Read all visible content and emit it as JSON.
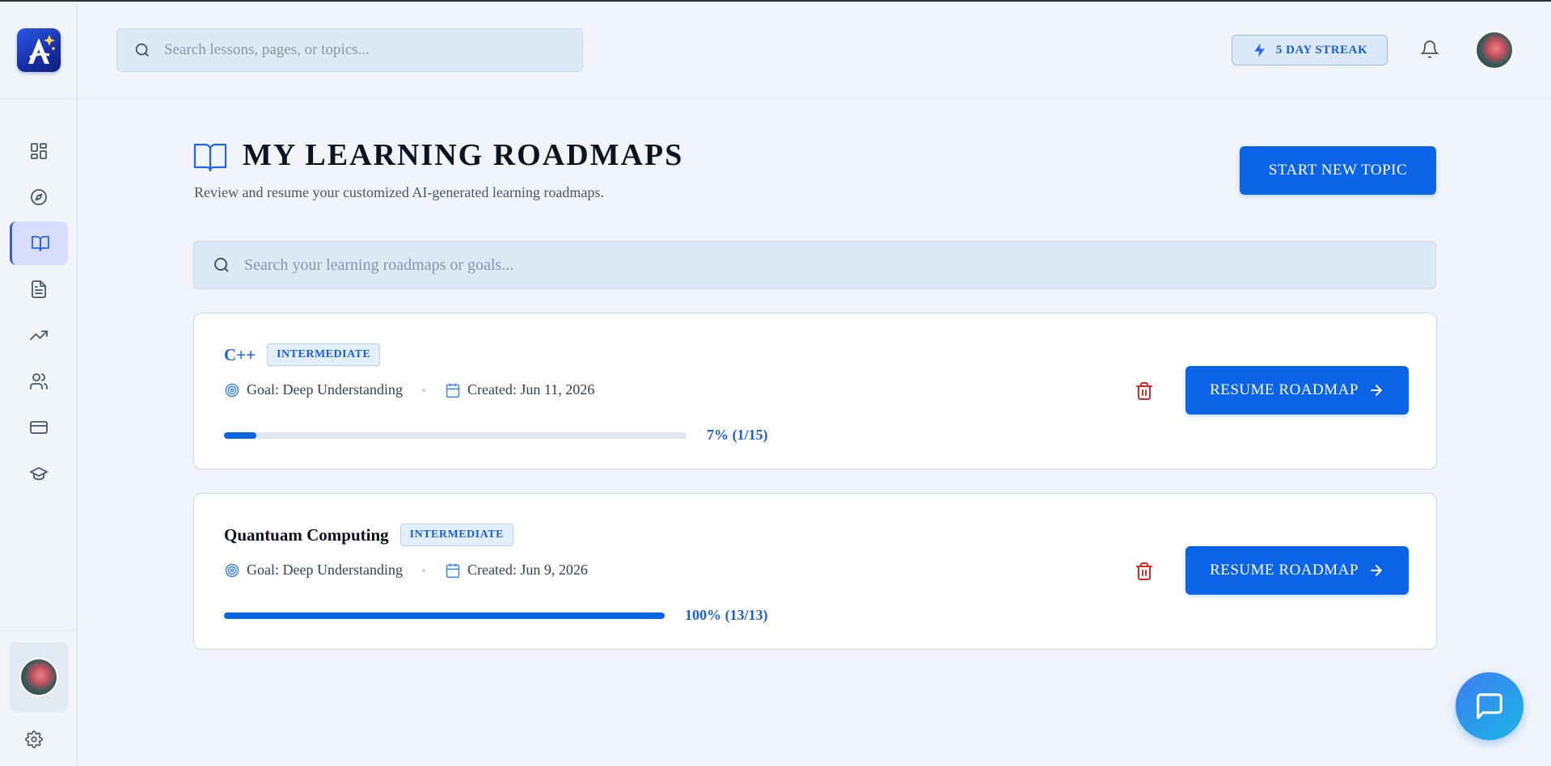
{
  "app": {
    "logo_letter": "A",
    "brand_color": "#0b63e5"
  },
  "topbar": {
    "search_placeholder": "Search lessons, pages, or topics...",
    "streak_label": "5 DAY STREAK"
  },
  "sidebar": {
    "items": [
      {
        "name": "dashboard",
        "icon": "grid-icon"
      },
      {
        "name": "explore",
        "icon": "compass-icon"
      },
      {
        "name": "roadmaps",
        "icon": "book-open-icon",
        "active": true
      },
      {
        "name": "documents",
        "icon": "file-text-icon"
      },
      {
        "name": "progress",
        "icon": "trending-up-icon"
      },
      {
        "name": "community",
        "icon": "users-icon"
      },
      {
        "name": "billing",
        "icon": "credit-card-icon"
      },
      {
        "name": "courses",
        "icon": "graduation-cap-icon"
      }
    ]
  },
  "main": {
    "title": "MY LEARNING ROADMAPS",
    "subtitle": "Review and resume your customized AI-generated learning roadmaps.",
    "start_button": "START NEW TOPIC",
    "search_placeholder": "Search your learning roadmaps or goals..."
  },
  "roadmaps": [
    {
      "title": "C++",
      "level": "INTERMEDIATE",
      "goal": "Goal: Deep Understanding",
      "created": "Created: Jun 11, 2026",
      "progress_fraction": 0.07,
      "progress_label": "7% (1/15)",
      "resume_label": "RESUME ROADMAP"
    },
    {
      "title": "Quantuam Computing",
      "level": "INTERMEDIATE",
      "goal": "Goal: Deep Understanding",
      "created": "Created: Jun 9, 2026",
      "progress_fraction": 1.0,
      "progress_label": "100% (13/13)",
      "resume_label": "RESUME ROADMAP"
    }
  ]
}
